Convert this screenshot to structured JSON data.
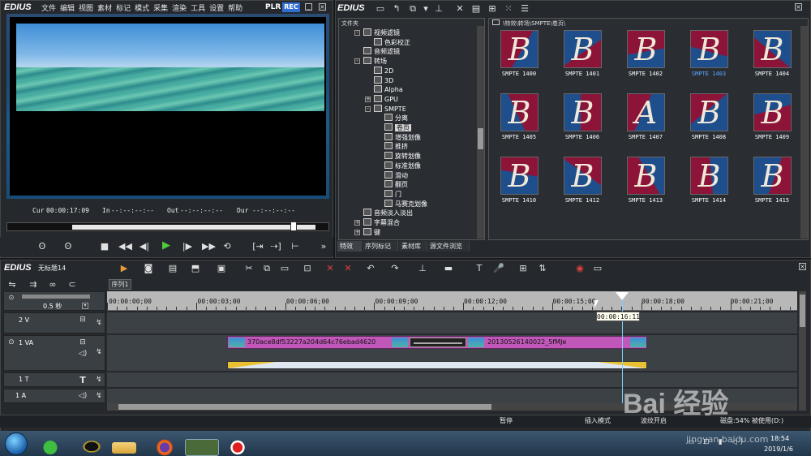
{
  "player": {
    "logo": "EDIUS",
    "menu": [
      "文件",
      "编辑",
      "视图",
      "素材",
      "标记",
      "模式",
      "采集",
      "渲染",
      "工具",
      "设置",
      "帮助"
    ],
    "plr": "PLR",
    "rec": "REC",
    "cur_label": "Cur",
    "cur_value": "00:00:17:09",
    "in_label": "In",
    "in_value": "--:--:--:--",
    "out_label": "Out",
    "out_value": "--:--:--:--",
    "dur_label": "Dur",
    "dur_value": "--:--:--:--"
  },
  "effects": {
    "logo": "EDIUS",
    "folder_header": "文件夹",
    "path": "\\特效\\转场\\SMPTE\\卷页\\",
    "tree": [
      {
        "label": "视频滤镜",
        "indent": 0,
        "exp": "-"
      },
      {
        "label": "色彩校正",
        "indent": 1,
        "exp": ""
      },
      {
        "label": "音频滤镜",
        "indent": 0,
        "exp": ""
      },
      {
        "label": "转场",
        "indent": 0,
        "exp": "-"
      },
      {
        "label": "2D",
        "indent": 1,
        "exp": ""
      },
      {
        "label": "3D",
        "indent": 1,
        "exp": ""
      },
      {
        "label": "Alpha",
        "indent": 1,
        "exp": ""
      },
      {
        "label": "GPU",
        "indent": 1,
        "exp": "+"
      },
      {
        "label": "SMPTE",
        "indent": 1,
        "exp": "-"
      },
      {
        "label": "分离",
        "indent": 2,
        "exp": ""
      },
      {
        "label": "卷页",
        "indent": 2,
        "exp": "",
        "selected": true
      },
      {
        "label": "增强划像",
        "indent": 2,
        "exp": ""
      },
      {
        "label": "推挤",
        "indent": 2,
        "exp": ""
      },
      {
        "label": "旋转划像",
        "indent": 2,
        "exp": ""
      },
      {
        "label": "标准划像",
        "indent": 2,
        "exp": ""
      },
      {
        "label": "滑动",
        "indent": 2,
        "exp": ""
      },
      {
        "label": "翻页",
        "indent": 2,
        "exp": ""
      },
      {
        "label": "门",
        "indent": 2,
        "exp": ""
      },
      {
        "label": "马赛克划像",
        "indent": 2,
        "exp": ""
      },
      {
        "label": "音频淡入淡出",
        "indent": 0,
        "exp": ""
      },
      {
        "label": "字幕混合",
        "indent": 0,
        "exp": "+"
      },
      {
        "label": "键",
        "indent": 0,
        "exp": "+"
      }
    ],
    "thumbs": [
      {
        "name": "SMPTE 1400",
        "letter": "B",
        "bg": "#8c1438",
        "accent": "#1e4e8c",
        "selected": false
      },
      {
        "name": "SMPTE 1401",
        "letter": "B",
        "bg": "#1e4e8c",
        "accent": "#8c1438",
        "selected": false
      },
      {
        "name": "SMPTE 1402",
        "letter": "B",
        "bg": "#8c1438",
        "accent": "#1e4e8c",
        "selected": false
      },
      {
        "name": "SMPTE 1403",
        "letter": "B",
        "bg": "#8c1438",
        "accent": "#1e4e8c",
        "selected": true
      },
      {
        "name": "SMPTE 1404",
        "letter": "B",
        "bg": "#1e4e8c",
        "accent": "#8c1438",
        "selected": false
      },
      {
        "name": "SMPTE 1405",
        "letter": "B",
        "bg": "#8c1438",
        "accent": "#1e4e8c",
        "selected": false
      },
      {
        "name": "SMPTE 1406",
        "letter": "B",
        "bg": "#8c1438",
        "accent": "#1e4e8c",
        "selected": false
      },
      {
        "name": "SMPTE 1407",
        "letter": "A",
        "bg": "#1e4e8c",
        "accent": "#8c1438",
        "selected": false
      },
      {
        "name": "SMPTE 1408",
        "letter": "B",
        "bg": "#1e4e8c",
        "accent": "#8c1438",
        "selected": false
      },
      {
        "name": "SMPTE 1409",
        "letter": "B",
        "bg": "#8c1438",
        "accent": "#1e4e8c",
        "selected": false
      },
      {
        "name": "SMPTE 1410",
        "letter": "B",
        "bg": "#1e4e8c",
        "accent": "#8c1438",
        "selected": false
      },
      {
        "name": "SMPTE 1412",
        "letter": "B",
        "bg": "#1e4e8c",
        "accent": "#8c1438",
        "selected": false
      },
      {
        "name": "SMPTE 1413",
        "letter": "B",
        "bg": "#8c1438",
        "accent": "#1e4e8c",
        "selected": false
      },
      {
        "name": "SMPTE 1414",
        "letter": "B",
        "bg": "#8c1438",
        "accent": "#1e4e8c",
        "selected": false
      },
      {
        "name": "SMPTE 1415",
        "letter": "B",
        "bg": "#1e4e8c",
        "accent": "#8c1438",
        "selected": false
      }
    ],
    "tabs": [
      "特效",
      "序列标记",
      "素材库",
      "源文件浏览"
    ]
  },
  "timeline": {
    "logo": "EDIUS",
    "project": "无标题14",
    "sequence_tab": "序列1",
    "zoom_value": "0.5 秒",
    "ruler": [
      "00:00:00;00",
      "00:00:03;00",
      "00:00:06;00",
      "00:00:09;00",
      "00:00:12;00",
      "00:00:15;00",
      "00:00:18;00",
      "00:00:21;00"
    ],
    "playhead_tooltip": "00:00:16:11",
    "tracks": {
      "v2": "2 V",
      "va1": "1 VA",
      "t1": "1 T",
      "a1": "1 A"
    },
    "clip1_name": "370ace8df53227a204d64c76ebad4620",
    "clip2_name": "20130526140022_5fMJe",
    "status": {
      "pause": "暂停",
      "insert": "插入模式",
      "ripple": "波纹开启",
      "disk": "磁盘:54% 被使用(D:)"
    }
  },
  "taskbar": {
    "time": "18:54",
    "date": "2019/1/6"
  },
  "watermark": {
    "text": "Bai 经验",
    "url": "jingyan.baidu.com"
  },
  "colors": {
    "clip": "#c158b9",
    "rec_badge": "#2f6fd2",
    "play_green": "#4ecc3a",
    "selected_thumb_label": "#5aa6ff"
  }
}
